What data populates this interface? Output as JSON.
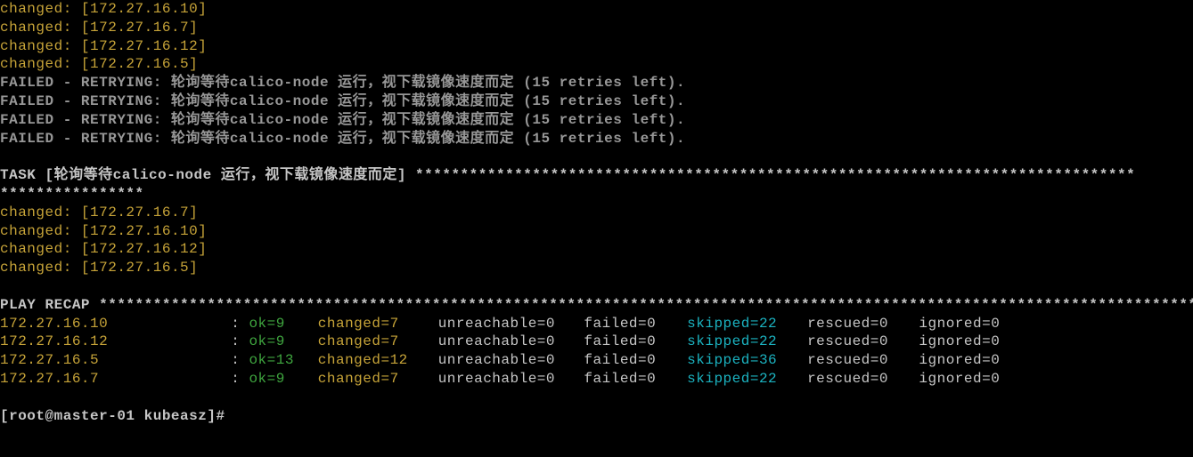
{
  "changed_block1": [
    {
      "label": "changed:",
      "host": "[172.27.16.10]"
    },
    {
      "label": "changed:",
      "host": "[172.27.16.7]"
    },
    {
      "label": "changed:",
      "host": "[172.27.16.12]"
    },
    {
      "label": "changed:",
      "host": "[172.27.16.5]"
    }
  ],
  "failed_retry_lines": [
    "FAILED - RETRYING: 轮询等待calico-node 运行，视下载镜像速度而定 (15 retries left).",
    "FAILED - RETRYING: 轮询等待calico-node 运行，视下载镜像速度而定 (15 retries left).",
    "FAILED - RETRYING: 轮询等待calico-node 运行，视下载镜像速度而定 (15 retries left).",
    "FAILED - RETRYING: 轮询等待calico-node 运行，视下载镜像速度而定 (15 retries left)."
  ],
  "task": {
    "prefix": "TASK [轮询等待calico-node 运行，视下载镜像速度而定] ",
    "asterisks_line1": "********************************************************************************",
    "asterisks_line2": "****************"
  },
  "changed_block2": [
    {
      "label": "changed:",
      "host": "[172.27.16.7]"
    },
    {
      "label": "changed:",
      "host": "[172.27.16.10]"
    },
    {
      "label": "changed:",
      "host": "[172.27.16.12]"
    },
    {
      "label": "changed:",
      "host": "[172.27.16.5]"
    }
  ],
  "recap": {
    "header": "PLAY RECAP ",
    "asterisks": "*********************************************************************************************************************************",
    "rows": [
      {
        "host": "172.27.16.10",
        "colon": ":",
        "ok": "ok=9",
        "changed": "changed=7",
        "unreachable": "unreachable=0",
        "failed": "failed=0",
        "skipped": "skipped=22",
        "rescued": "rescued=0",
        "ignored": "ignored=0"
      },
      {
        "host": "172.27.16.12",
        "colon": ":",
        "ok": "ok=9",
        "changed": "changed=7",
        "unreachable": "unreachable=0",
        "failed": "failed=0",
        "skipped": "skipped=22",
        "rescued": "rescued=0",
        "ignored": "ignored=0"
      },
      {
        "host": "172.27.16.5",
        "colon": ":",
        "ok": "ok=13",
        "changed": "changed=12",
        "unreachable": "unreachable=0",
        "failed": "failed=0",
        "skipped": "skipped=36",
        "rescued": "rescued=0",
        "ignored": "ignored=0"
      },
      {
        "host": "172.27.16.7",
        "colon": ":",
        "ok": "ok=9",
        "changed": "changed=7",
        "unreachable": "unreachable=0",
        "failed": "failed=0",
        "skipped": "skipped=22",
        "rescued": "rescued=0",
        "ignored": "ignored=0"
      }
    ]
  },
  "prompt": "[root@master-01 kubeasz]#"
}
